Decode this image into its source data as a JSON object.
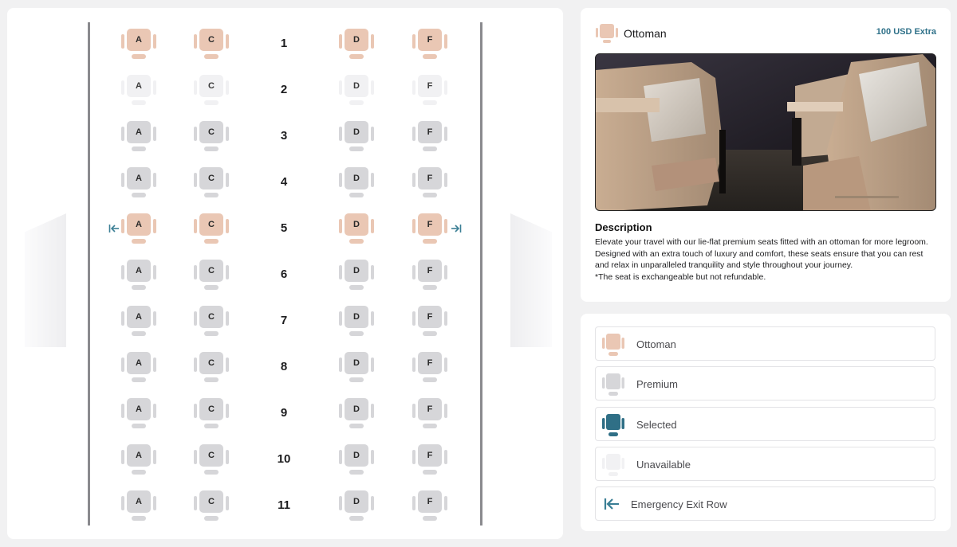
{
  "seat_map": {
    "left_columns": [
      "A",
      "C"
    ],
    "right_columns": [
      "D",
      "F"
    ],
    "rows": [
      {
        "number": "1",
        "seat_type": "ottoman",
        "exit": false
      },
      {
        "number": "2",
        "seat_type": "unavailable",
        "exit": false
      },
      {
        "number": "3",
        "seat_type": "premium",
        "exit": false
      },
      {
        "number": "4",
        "seat_type": "premium",
        "exit": false
      },
      {
        "number": "5",
        "seat_type": "ottoman",
        "exit": true
      },
      {
        "number": "6",
        "seat_type": "premium",
        "exit": false
      },
      {
        "number": "7",
        "seat_type": "premium",
        "exit": false
      },
      {
        "number": "8",
        "seat_type": "premium",
        "exit": false
      },
      {
        "number": "9",
        "seat_type": "premium",
        "exit": false
      },
      {
        "number": "10",
        "seat_type": "premium",
        "exit": false
      },
      {
        "number": "11",
        "seat_type": "premium",
        "exit": false
      }
    ]
  },
  "detail": {
    "title": "Ottoman",
    "price": "100 USD Extra",
    "description_heading": "Description",
    "description": "Elevate your travel with our lie-flat premium seats fitted with an ottoman for more legroom. Designed with an extra touch of luxury and comfort, these seats ensure that you can rest and relax in unparalleled tranquility and style throughout your journey.",
    "note": "*The seat is exchangeable but not refundable."
  },
  "legend": [
    {
      "label": "Ottoman",
      "kind": "ottoman"
    },
    {
      "label": "Premium",
      "kind": "premium"
    },
    {
      "label": "Selected",
      "kind": "selected"
    },
    {
      "label": "Unavailable",
      "kind": "unavailable"
    },
    {
      "label": "Emergency Exit Row",
      "kind": "exit"
    }
  ],
  "colors": {
    "ottoman": "#eac7b4",
    "premium": "#d6d6d9",
    "selected": "#2f6f86",
    "unavailable": "#f1f1f3",
    "exit_arrow": "#3b7f95",
    "price": "#2f7189"
  },
  "icons": {
    "exit_left": "arrow-left-to-bar-icon",
    "exit_right": "arrow-right-to-bar-icon",
    "seat": "seat-icon"
  }
}
